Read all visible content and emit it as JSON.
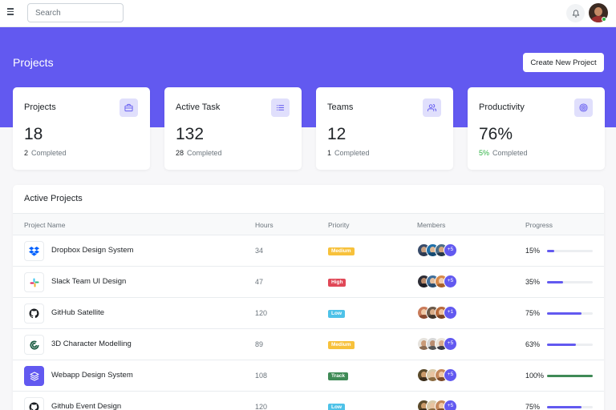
{
  "topbar": {
    "search_placeholder": "Search",
    "icons": [
      "menu-icon",
      "bell-icon"
    ]
  },
  "header": {
    "title": "Projects",
    "create_button": "Create New Project"
  },
  "colors": {
    "accent": "#6259f0",
    "accent_light": "#e0dffc",
    "success": "#2fb344"
  },
  "stats": [
    {
      "title": "Projects",
      "value": "18",
      "count": "2",
      "sub": "Completed",
      "icon": "briefcase-icon"
    },
    {
      "title": "Active Task",
      "value": "132",
      "count": "28",
      "sub": "Completed",
      "icon": "list-icon"
    },
    {
      "title": "Teams",
      "value": "12",
      "count": "1",
      "sub": "Completed",
      "icon": "users-icon"
    },
    {
      "title": "Productivity",
      "value": "76%",
      "count": "5%",
      "sub": "Completed",
      "icon": "target-icon"
    }
  ],
  "table": {
    "title": "Active Projects",
    "columns": [
      "Project Name",
      "Hours",
      "Priority",
      "Members",
      "Progress"
    ],
    "rows": [
      {
        "name": "Dropbox Design System",
        "hours": "34",
        "priority": "Medium",
        "priority_color": "#f7c13b",
        "more": "+5",
        "progress": "15%",
        "progress_value": 0.15,
        "bar_color": "#6259f0",
        "logo": "dropbox-icon"
      },
      {
        "name": "Slack Team UI Design",
        "hours": "47",
        "priority": "High",
        "priority_color": "#e04857",
        "more": "+5",
        "progress": "35%",
        "progress_value": 0.35,
        "bar_color": "#6259f0",
        "logo": "slack-icon"
      },
      {
        "name": "GitHub Satellite",
        "hours": "120",
        "priority": "Low",
        "priority_color": "#4ec2e8",
        "more": "+1",
        "progress": "75%",
        "progress_value": 0.75,
        "bar_color": "#6259f0",
        "logo": "github-icon"
      },
      {
        "name": "3D Character Modelling",
        "hours": "89",
        "priority": "Medium",
        "priority_color": "#f7c13b",
        "more": "+5",
        "progress": "63%",
        "progress_value": 0.63,
        "bar_color": "#6259f0",
        "logo": "modelling-icon"
      },
      {
        "name": "Webapp Design System",
        "hours": "108",
        "priority": "Track",
        "priority_color": "#3f8a56",
        "more": "+5",
        "progress": "100%",
        "progress_value": 1.0,
        "bar_color": "#3f8a56",
        "logo": "layers-icon"
      },
      {
        "name": "Github Event Design",
        "hours": "120",
        "priority": "Low",
        "priority_color": "#4ec2e8",
        "more": "+5",
        "progress": "75%",
        "progress_value": 0.75,
        "bar_color": "#6259f0",
        "logo": "github-icon"
      }
    ]
  }
}
